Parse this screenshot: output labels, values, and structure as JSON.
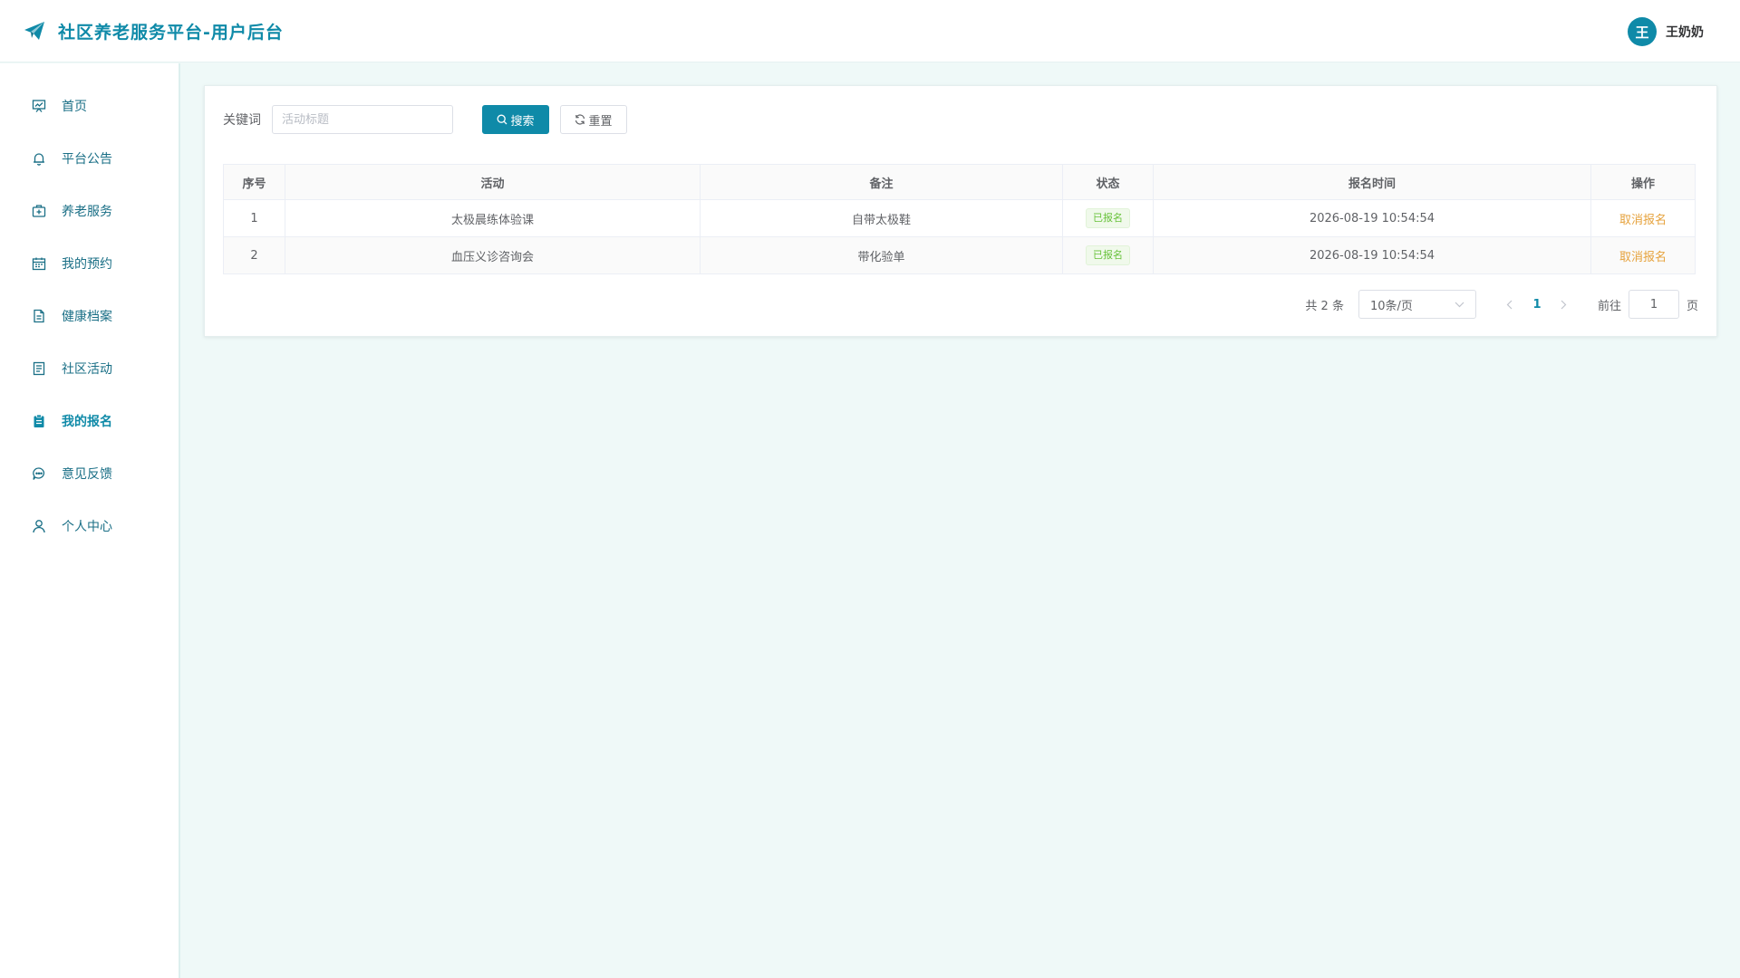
{
  "header": {
    "title": "社区养老服务平台-用户后台",
    "logo_icon": "paper-plane-icon",
    "user": {
      "avatar_text": "王",
      "name": "王奶奶"
    }
  },
  "sidebar": {
    "items": [
      {
        "label": "首页",
        "icon": "dashboard-icon"
      },
      {
        "label": "平台公告",
        "icon": "bell-icon"
      },
      {
        "label": "养老服务",
        "icon": "medical-kit-icon"
      },
      {
        "label": "我的预约",
        "icon": "calendar-icon"
      },
      {
        "label": "健康档案",
        "icon": "document-icon"
      },
      {
        "label": "社区活动",
        "icon": "notes-icon"
      },
      {
        "label": "我的报名",
        "icon": "clipboard-icon",
        "active": true
      },
      {
        "label": "意见反馈",
        "icon": "chat-icon"
      },
      {
        "label": "个人中心",
        "icon": "user-icon"
      }
    ]
  },
  "search": {
    "label": "关键词",
    "placeholder": "活动标题",
    "value": "",
    "search_button": "搜索",
    "reset_button": "重置"
  },
  "table": {
    "columns": [
      "序号",
      "活动",
      "备注",
      "状态",
      "报名时间",
      "操作"
    ],
    "rows": [
      {
        "index": "1",
        "activity": "太极晨练体验课",
        "remark": "自带太极鞋",
        "status": "已报名",
        "time": "2026-08-19 10:54:54",
        "action": "取消报名"
      },
      {
        "index": "2",
        "activity": "血压义诊咨询会",
        "remark": "带化验单",
        "status": "已报名",
        "time": "2026-08-19 10:54:54",
        "action": "取消报名"
      }
    ]
  },
  "pagination": {
    "total_text": "共 2 条",
    "page_size": "10条/页",
    "current_page": "1",
    "goto_label": "前往",
    "goto_value": "1",
    "page_suffix": "页"
  },
  "colors": {
    "primary": "#0f8aa8",
    "success": "#67c23a",
    "warning": "#e6a23c",
    "page_background": "#eff9f8"
  }
}
